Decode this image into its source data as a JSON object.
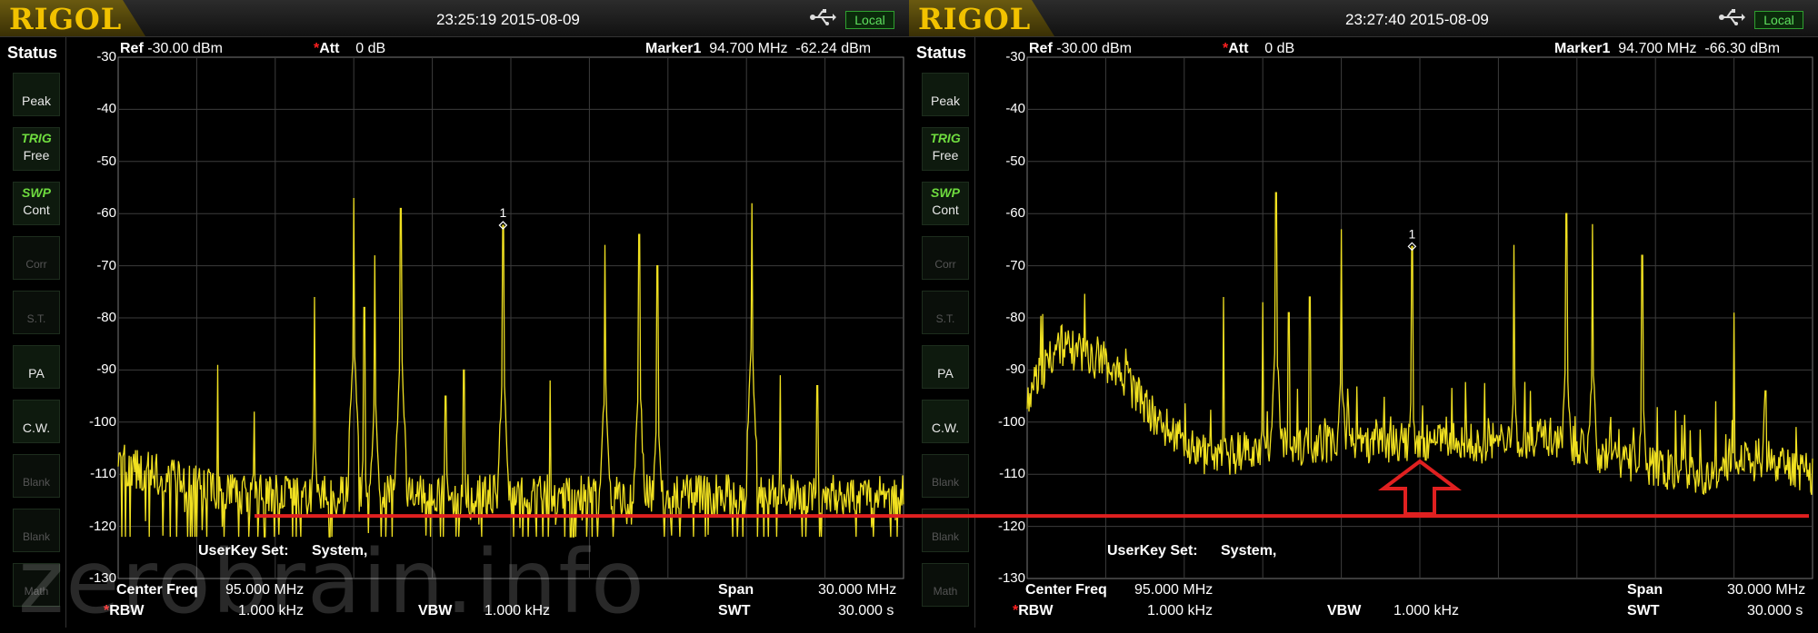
{
  "watermark": "zerobrain.info",
  "colors": {
    "trace": "#f0e020",
    "grid": "#3c3c3c",
    "annotation": "#e02020",
    "logo": "#f2c200"
  },
  "screens": [
    {
      "logo": "RIGOL",
      "datetime": "23:25:19 2015-08-09",
      "local_label": "Local",
      "usb_icon": "usb-icon",
      "status_label": "Status",
      "sidebar": [
        {
          "icon": "peak-icon",
          "top": "",
          "label": "Peak"
        },
        {
          "icon": "trig-icon",
          "top": "TRIG",
          "label": "Free"
        },
        {
          "icon": "swp-icon",
          "top": "SWP",
          "label": "Cont"
        },
        {
          "icon": "corr-icon",
          "top": "",
          "label": "Corr"
        },
        {
          "icon": "st-icon",
          "top": "",
          "label": "S.T."
        },
        {
          "icon": "pa-icon",
          "top": "",
          "label": "PA"
        },
        {
          "icon": "cw-icon",
          "top": "",
          "label": "C.W."
        },
        {
          "icon": "blank-icon",
          "top": "",
          "label": "Blank"
        },
        {
          "icon": "blank-icon",
          "top": "",
          "label": "Blank"
        },
        {
          "icon": "math-icon",
          "top": "",
          "label": "Math"
        }
      ],
      "header": {
        "ref_label": "Ref",
        "ref_value": "-30.00 dBm",
        "att_star": "*",
        "att_label": "Att",
        "att_value": "0 dB",
        "marker_label": "Marker1",
        "marker_freq": "94.700 MHz",
        "marker_level": "-62.24 dBm"
      },
      "y_ticks": [
        "-30",
        "-40",
        "-50",
        "-60",
        "-70",
        "-80",
        "-90",
        "-100",
        "-110",
        "-120",
        "-130"
      ],
      "userkey_label": "UserKey Set:",
      "userkey_value": "System,",
      "footer": {
        "center_label": "Center Freq",
        "center_value": "95.000 MHz",
        "span_label": "Span",
        "span_value": "30.000 MHz",
        "rbw_star": "*",
        "rbw_label": "RBW",
        "rbw_value": "1.000 kHz",
        "vbw_label": "VBW",
        "vbw_value": "1.000 kHz",
        "swt_label": "SWT",
        "swt_value": "30.000 s"
      },
      "marker_id": "1"
    },
    {
      "logo": "RIGOL",
      "datetime": "23:27:40 2015-08-09",
      "local_label": "Local",
      "usb_icon": "usb-icon",
      "status_label": "Status",
      "sidebar": [
        {
          "icon": "peak-icon",
          "top": "",
          "label": "Peak"
        },
        {
          "icon": "trig-icon",
          "top": "TRIG",
          "label": "Free"
        },
        {
          "icon": "swp-icon",
          "top": "SWP",
          "label": "Cont"
        },
        {
          "icon": "corr-icon",
          "top": "",
          "label": "Corr"
        },
        {
          "icon": "st-icon",
          "top": "",
          "label": "S.T."
        },
        {
          "icon": "pa-icon",
          "top": "",
          "label": "PA"
        },
        {
          "icon": "cw-icon",
          "top": "",
          "label": "C.W."
        },
        {
          "icon": "blank-icon",
          "top": "",
          "label": "Blank"
        },
        {
          "icon": "blank-icon",
          "top": "",
          "label": "Blank"
        },
        {
          "icon": "math-icon",
          "top": "",
          "label": "Math"
        }
      ],
      "header": {
        "ref_label": "Ref",
        "ref_value": "-30.00 dBm",
        "att_star": "*",
        "att_label": "Att",
        "att_value": "0 dB",
        "marker_label": "Marker1",
        "marker_freq": "94.700 MHz",
        "marker_level": "-66.30 dBm"
      },
      "y_ticks": [
        "-30",
        "-40",
        "-50",
        "-60",
        "-70",
        "-80",
        "-90",
        "-100",
        "-110",
        "-120",
        "-130"
      ],
      "userkey_label": "UserKey Set:",
      "userkey_value": "System,",
      "footer": {
        "center_label": "Center Freq",
        "center_value": "95.000 MHz",
        "span_label": "Span",
        "span_value": "30.000 MHz",
        "rbw_star": "*",
        "rbw_label": "RBW",
        "rbw_value": "1.000 kHz",
        "vbw_label": "VBW",
        "vbw_value": "1.000 kHz",
        "swt_label": "SWT",
        "swt_value": "30.000 s"
      },
      "marker_id": "1"
    }
  ],
  "chart_data": [
    {
      "type": "line",
      "xlim": [
        80,
        110
      ],
      "ylim": [
        -130,
        -30
      ],
      "grid": true,
      "floor": -114,
      "start_level": -108,
      "end_level": -112,
      "noise_hump": [],
      "peaks": [
        [
          83.8,
          -89
        ],
        [
          85.2,
          -98
        ],
        [
          87.5,
          -76
        ],
        [
          89.0,
          -57
        ],
        [
          89.4,
          -78
        ],
        [
          89.8,
          -68
        ],
        [
          90.8,
          -59
        ],
        [
          92.5,
          -95
        ],
        [
          93.2,
          -90
        ],
        [
          94.7,
          -62.24
        ],
        [
          96.5,
          -92
        ],
        [
          98.6,
          -66
        ],
        [
          99.9,
          -64
        ],
        [
          100.6,
          -70
        ],
        [
          104.2,
          -58
        ],
        [
          105.3,
          -91
        ],
        [
          106.7,
          -93
        ]
      ],
      "marker": {
        "x": 94.7,
        "y": -62.24
      },
      "reference_line_y": -118
    },
    {
      "type": "line",
      "xlim": [
        80,
        110
      ],
      "ylim": [
        -130,
        -30
      ],
      "grid": true,
      "floor": -106,
      "start_level": -94,
      "end_level": -110,
      "noise_hump": [
        [
          80,
          -95
        ],
        [
          81.2,
          -85
        ],
        [
          82.5,
          -88
        ],
        [
          83.5,
          -90
        ],
        [
          85.0,
          -100
        ],
        [
          87.0,
          -107
        ],
        [
          89,
          -105
        ],
        [
          92,
          -104
        ],
        [
          95,
          -104
        ],
        [
          98,
          -104
        ],
        [
          100,
          -103
        ],
        [
          102,
          -106
        ],
        [
          104,
          -109
        ],
        [
          106,
          -110
        ],
        [
          108,
          -107
        ],
        [
          110,
          -110
        ]
      ],
      "peaks": [
        [
          87.5,
          -76
        ],
        [
          89.0,
          -77
        ],
        [
          89.5,
          -56
        ],
        [
          90.0,
          -79
        ],
        [
          90.8,
          -76
        ],
        [
          92.0,
          -63
        ],
        [
          94.7,
          -66.3
        ],
        [
          98.6,
          -66
        ],
        [
          100.6,
          -60
        ],
        [
          101.6,
          -62
        ],
        [
          103.5,
          -68
        ],
        [
          106.3,
          -96
        ],
        [
          107.0,
          -79
        ],
        [
          108.2,
          -94
        ]
      ],
      "marker": {
        "x": 94.7,
        "y": -66.3
      },
      "reference_line_y": -118,
      "arrow_x": 95.0
    }
  ]
}
